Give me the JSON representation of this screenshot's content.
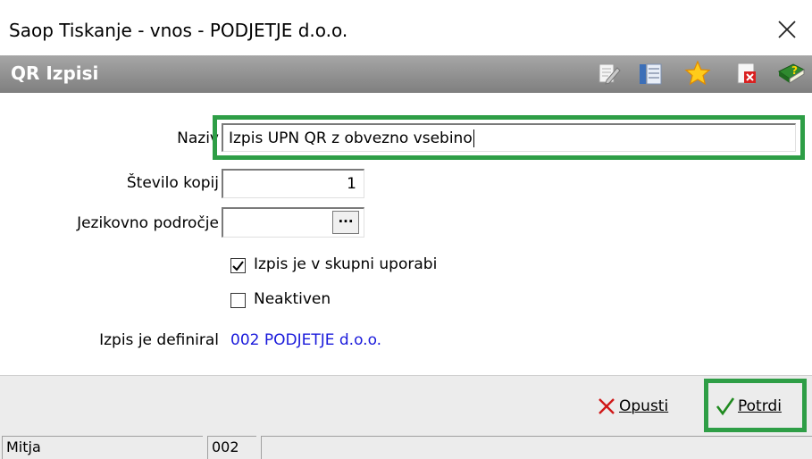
{
  "window": {
    "title": "Saop Tiskanje - vnos - PODJETJE d.o.o.",
    "close_glyph": "✕"
  },
  "header": {
    "title": "QR Izpisi",
    "icons": [
      "edit-icon",
      "list-icon",
      "favorite-star-icon",
      "delete-document-icon",
      "help-book-icon"
    ]
  },
  "form": {
    "naziv": {
      "label": "Naziv",
      "value": "Izpis UPN QR z obvezno vsebino"
    },
    "stevilo_kopij": {
      "label": "Število kopij",
      "value": "1"
    },
    "jezikovno_podrocje": {
      "label": "Jezikovno področje",
      "value": "",
      "browse_glyph": "···"
    },
    "skupna_uporaba": {
      "label": "Izpis je v skupni uporabi",
      "checked": true
    },
    "neaktiven": {
      "label": "Neaktiven",
      "checked": false
    },
    "definiral": {
      "label": "Izpis je definiral",
      "value": "002 PODJETJE d.o.o."
    }
  },
  "buttons": {
    "cancel": {
      "label": "Opusti"
    },
    "confirm": {
      "label": "Potrdi"
    }
  },
  "statusbar": {
    "user": "Mitja",
    "code": "002"
  },
  "colors": {
    "highlight": "#2e9e46",
    "link": "#1a1adb",
    "header": "#8c8c8c"
  }
}
